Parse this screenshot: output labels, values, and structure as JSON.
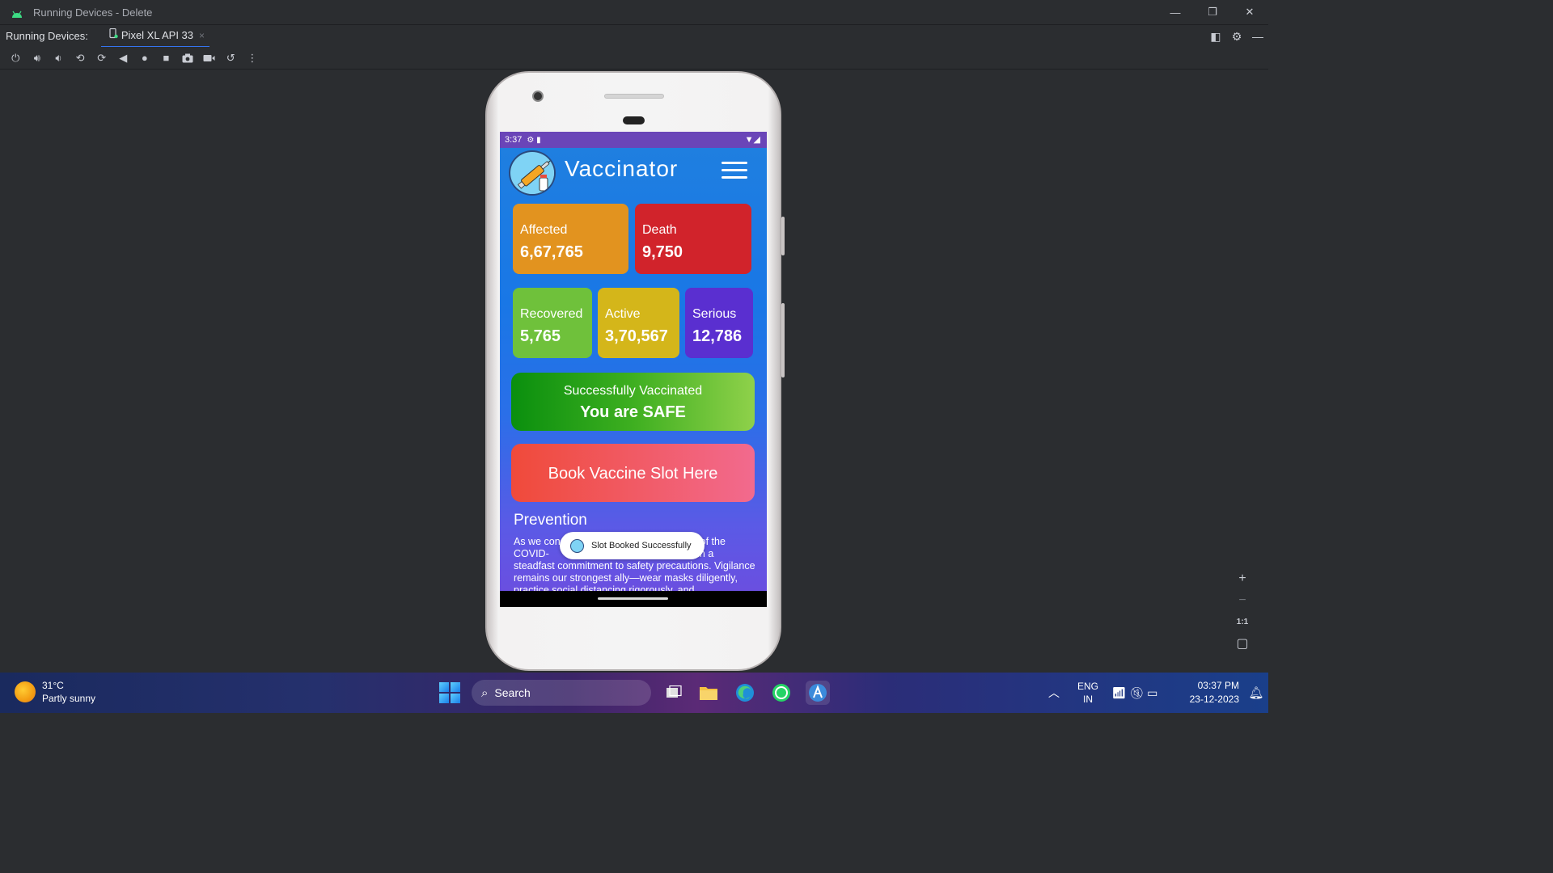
{
  "window": {
    "title": "Running Devices - Delete"
  },
  "tabbar": {
    "label": "Running Devices:",
    "active_tab": "Pixel XL API 33",
    "close_glyph": "×"
  },
  "toolbar": {
    "icons": [
      "power-icon",
      "volume-up-icon",
      "volume-down-icon",
      "rotate-left-icon",
      "rotate-right-icon",
      "back-icon",
      "home-icon",
      "overview-icon",
      "screenshot-icon",
      "screen-record-icon",
      "reset-icon",
      "more-options-icon"
    ]
  },
  "phone": {
    "status_time": "3:37",
    "app_title": "Vaccinator",
    "stats": {
      "affected": {
        "label": "Affected",
        "value": "6,67,765"
      },
      "death": {
        "label": "Death",
        "value": "9,750"
      },
      "recovered": {
        "label": "Recovered",
        "value": "5,765"
      },
      "active": {
        "label": "Active",
        "value": "3,70,567"
      },
      "serious": {
        "label": "Serious",
        "value": "12,786"
      }
    },
    "vaccinated": {
      "line1": "Successfully Vaccinated",
      "line2": "You are SAFE"
    },
    "book_button": "Book Vaccine Slot Here",
    "prevention": {
      "title": "Prevention",
      "text": "As we con                                        dvent of the COVID-                                       o maintain a steadfast commitment to safety precautions. Vigilance remains our strongest ally—wear masks diligently, practice social distancing rigorously, and"
    },
    "toast": "Slot Booked Successfully",
    "colors": {
      "affected": "#e2931f",
      "death": "#d1232b",
      "recovered": "#6fc13b",
      "active": "#d4b61a",
      "serious": "#5a2fd0"
    }
  },
  "zoom": {
    "plus": "+",
    "minus": "−",
    "one_to_one": "1:1"
  },
  "taskbar": {
    "weather_temp": "31°C",
    "weather_desc": "Partly sunny",
    "search_label": "Search",
    "lang_line1": "ENG",
    "lang_line2": "IN",
    "time": "03:37 PM",
    "date": "23-12-2023"
  }
}
